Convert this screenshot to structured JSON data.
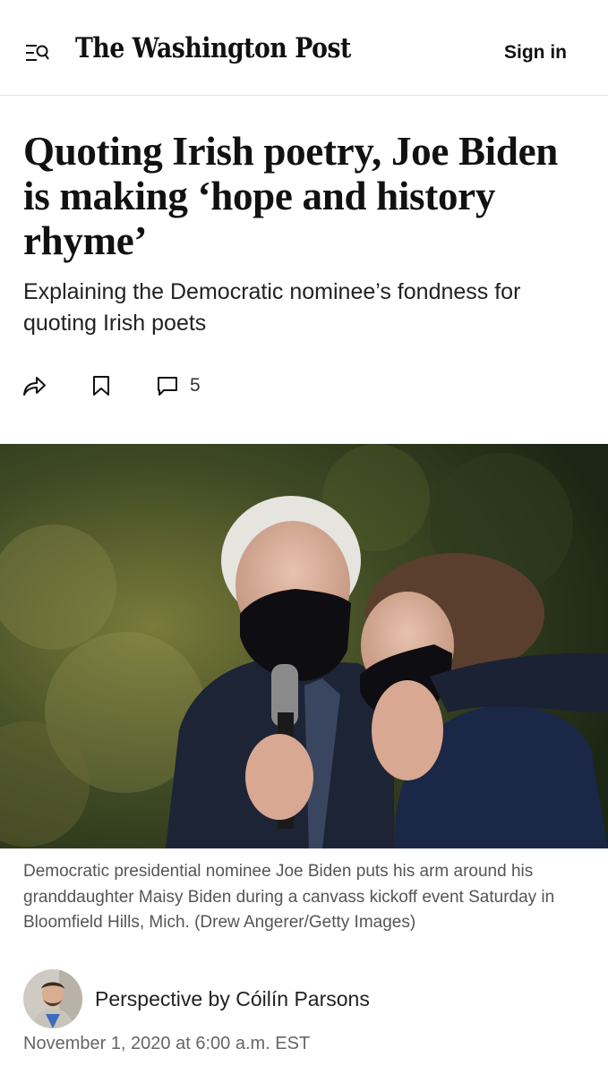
{
  "header": {
    "logo_text": "The Washington Post",
    "signin_label": "Sign in",
    "menu_icon": "menu-search-icon"
  },
  "article": {
    "headline": "Quoting Irish poetry, Joe Biden is making ‘hope and history rhyme’",
    "subheadline": "Explaining the Democratic nominee’s fondness for quoting Irish poets",
    "actions": {
      "share_icon": "share-arrow-icon",
      "bookmark_icon": "bookmark-icon",
      "comment_icon": "comment-icon",
      "comment_count": "5"
    },
    "photo_caption": "Democratic presidential nominee Joe Biden puts his arm around his granddaughter Maisy Biden during a canvass kickoff event Saturday in Bloomfield Hills, Mich. (Drew Angerer/Getty Images)",
    "byline_prefix": "Perspective by ",
    "author": "Cóilín Parsons",
    "date": "November 1, 2020 at 6:00 a.m. EST"
  },
  "colors": {
    "text": "#111111",
    "caption": "#555555",
    "divider": "#e2e2e2",
    "mask": "#0e0e12",
    "jacket": "#1b2438"
  }
}
